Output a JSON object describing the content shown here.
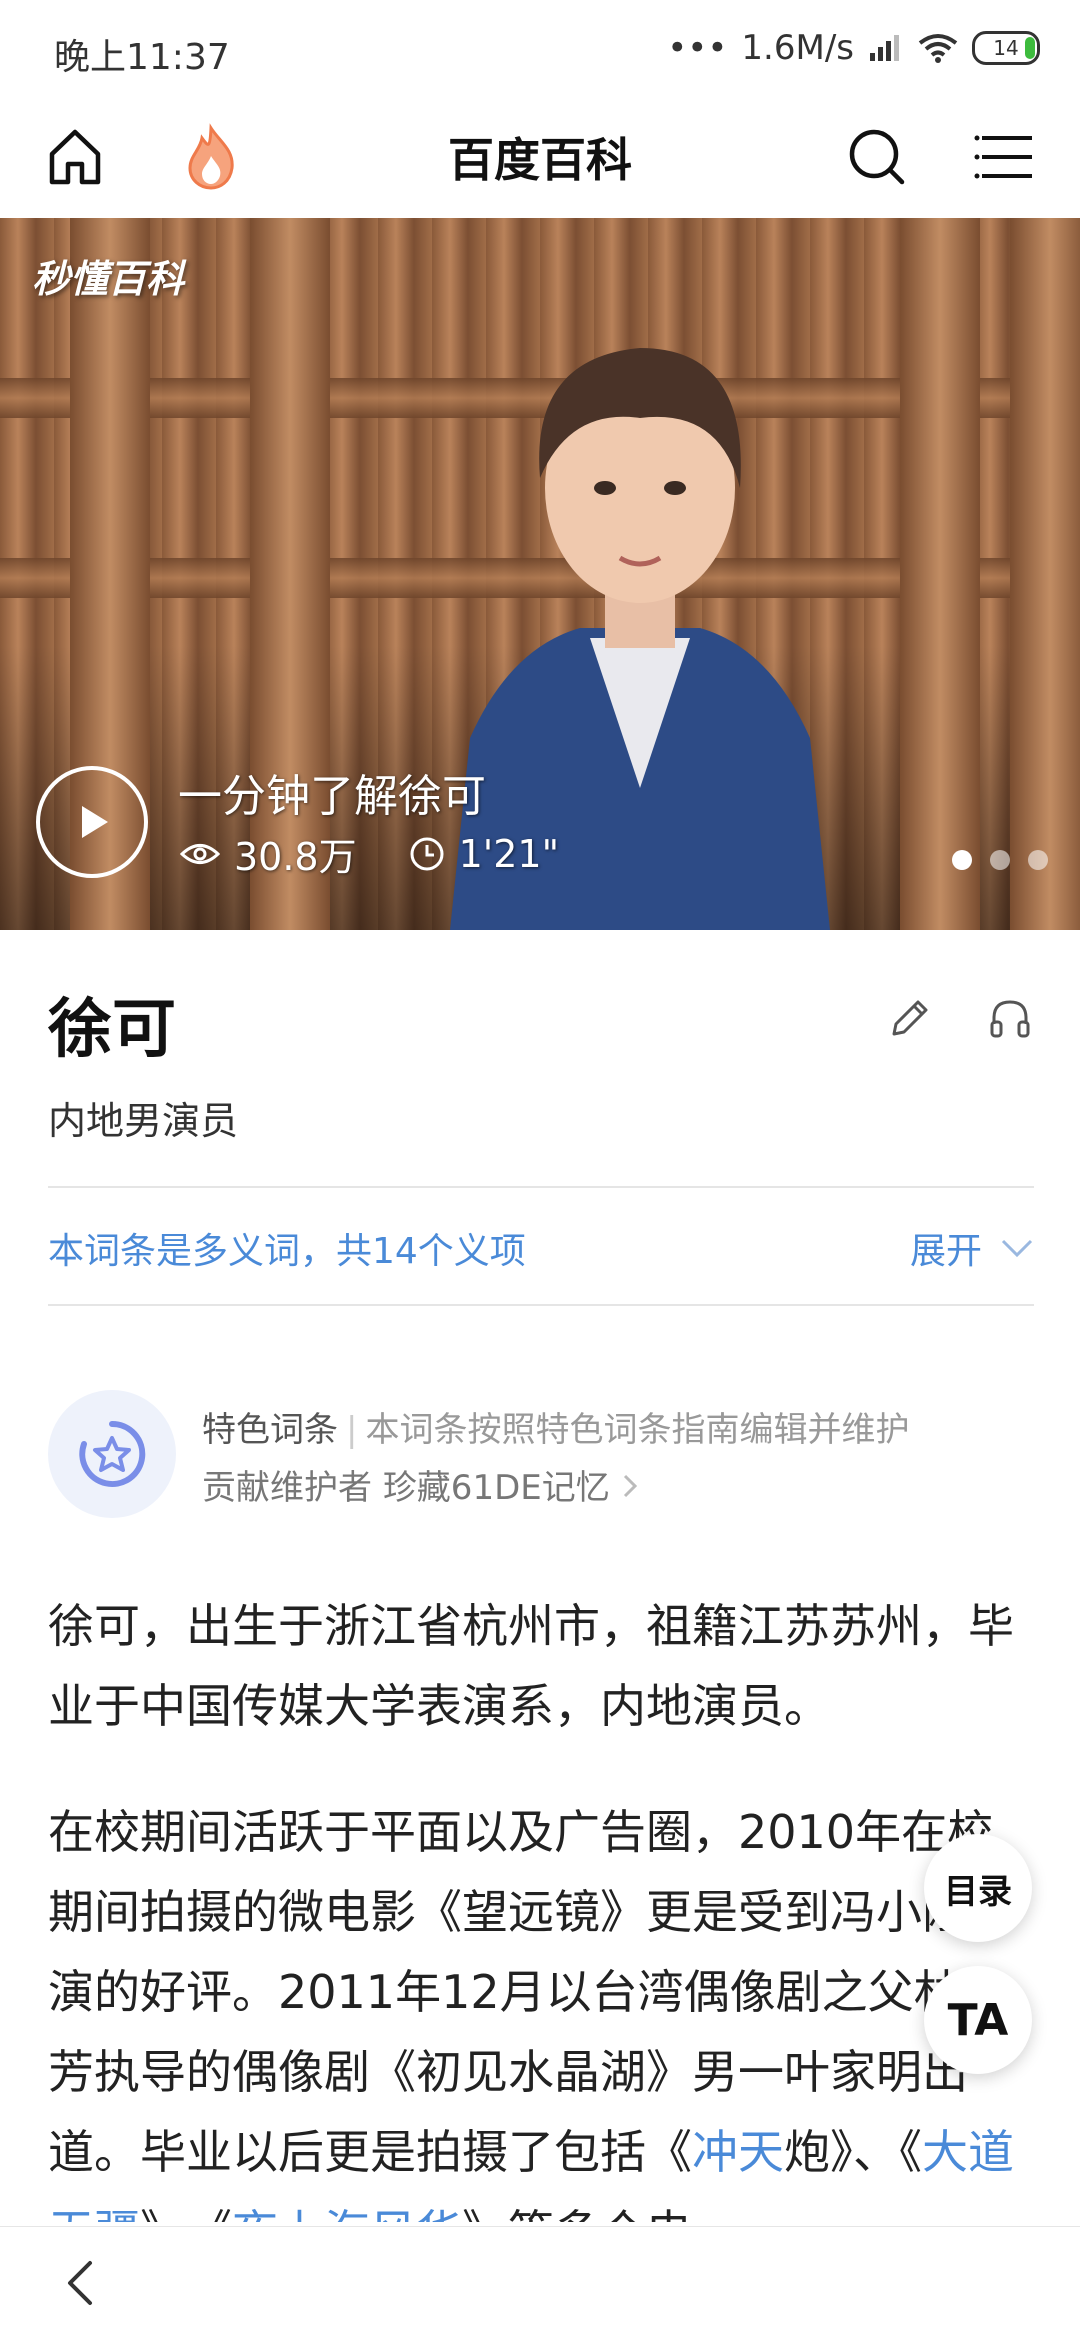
{
  "status_bar": {
    "time": "晚上11:37",
    "network_speed": "1.6M/s",
    "battery": "14"
  },
  "header": {
    "title": "百度百科"
  },
  "hero": {
    "brand_logo": "秒懂百科",
    "video_title": "一分钟了解徐可",
    "views": "30.8万",
    "duration": "1'21\"",
    "slide_count": 3,
    "active_slide": 1
  },
  "entry": {
    "name": "徐可",
    "description": "内地男演员"
  },
  "polysemy": {
    "text": "本词条是多义词，共14个义项",
    "expand_label": "展开"
  },
  "featured": {
    "label": "特色词条",
    "note": "本词条按照特色词条指南编辑并维护",
    "contributor_prefix": "贡献维护者",
    "contributor_name": "珍藏61DE记忆"
  },
  "body": {
    "para1": "徐可，出生于浙江省杭州市，祖籍江苏苏州，毕业于中国传媒大学表演系，内地演员。",
    "para2_part1": "在校期间活跃于平面以及广告圈，2010年在校期间拍摄的微电影《望远镜》更是受到冯小刚导演的好评。2011年12月以台湾偶像剧之父林清芳执导的偶像剧《初见水晶湖》男一叶家明出道。毕业以后更是拍摄了包括《",
    "para2_link1": "冲天",
    "para2_part2": "炮》、《",
    "para2_link2": "大道无疆",
    "para2_part3": "》、《",
    "para2_link3": "夜上海风华",
    "para2_part4": "》等多个电"
  },
  "floating": {
    "toc_label": "目录",
    "ta_label": "TA"
  }
}
